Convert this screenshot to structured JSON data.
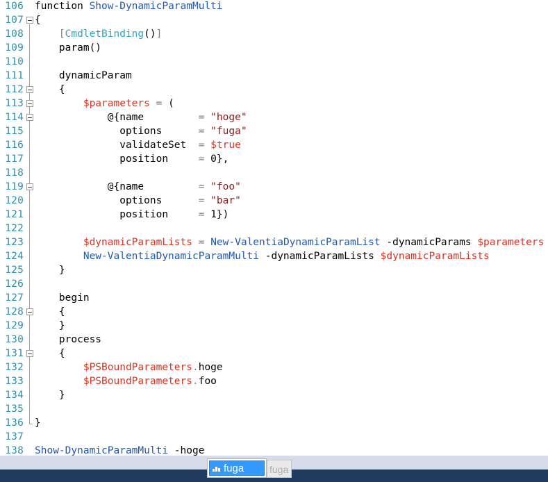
{
  "editor": {
    "lines": [
      {
        "n": "106",
        "fold": false,
        "tokens": [
          [
            "kw",
            "function "
          ],
          [
            "fn",
            "Show-DynamicParamMulti"
          ]
        ]
      },
      {
        "n": "107",
        "fold": true,
        "tokens": [
          [
            "plain",
            "{"
          ]
        ]
      },
      {
        "n": "108",
        "fold": false,
        "tokens": [
          [
            "plain",
            "    "
          ],
          [
            "op",
            "["
          ],
          [
            "attr",
            "CmdletBinding"
          ],
          [
            "plain",
            "()"
          ],
          [
            "op",
            "]"
          ]
        ]
      },
      {
        "n": "109",
        "fold": false,
        "tokens": [
          [
            "plain",
            "    param()"
          ]
        ]
      },
      {
        "n": "110",
        "fold": false,
        "tokens": []
      },
      {
        "n": "111",
        "fold": false,
        "tokens": [
          [
            "plain",
            "    dynamicParam"
          ]
        ]
      },
      {
        "n": "112",
        "fold": true,
        "tokens": [
          [
            "plain",
            "    {"
          ]
        ]
      },
      {
        "n": "113",
        "fold": true,
        "tokens": [
          [
            "plain",
            "        "
          ],
          [
            "var",
            "$parameters"
          ],
          [
            "plain",
            " "
          ],
          [
            "op",
            "="
          ],
          [
            "plain",
            " ("
          ]
        ]
      },
      {
        "n": "114",
        "fold": true,
        "tokens": [
          [
            "plain",
            "            @{name         "
          ],
          [
            "op",
            "="
          ],
          [
            "plain",
            " "
          ],
          [
            "str",
            "\"hoge\""
          ]
        ]
      },
      {
        "n": "115",
        "fold": false,
        "tokens": [
          [
            "plain",
            "              options      "
          ],
          [
            "op",
            "="
          ],
          [
            "plain",
            " "
          ],
          [
            "str",
            "\"fuga\""
          ]
        ]
      },
      {
        "n": "116",
        "fold": false,
        "tokens": [
          [
            "plain",
            "              validateSet  "
          ],
          [
            "op",
            "="
          ],
          [
            "plain",
            " "
          ],
          [
            "var",
            "$true"
          ]
        ]
      },
      {
        "n": "117",
        "fold": false,
        "tokens": [
          [
            "plain",
            "              position     "
          ],
          [
            "op",
            "="
          ],
          [
            "plain",
            " 0},"
          ]
        ]
      },
      {
        "n": "118",
        "fold": false,
        "tokens": []
      },
      {
        "n": "119",
        "fold": true,
        "tokens": [
          [
            "plain",
            "            @{name         "
          ],
          [
            "op",
            "="
          ],
          [
            "plain",
            " "
          ],
          [
            "str",
            "\"foo\""
          ]
        ]
      },
      {
        "n": "120",
        "fold": false,
        "tokens": [
          [
            "plain",
            "              options      "
          ],
          [
            "op",
            "="
          ],
          [
            "plain",
            " "
          ],
          [
            "str",
            "\"bar\""
          ]
        ]
      },
      {
        "n": "121",
        "fold": false,
        "tokens": [
          [
            "plain",
            "              position     "
          ],
          [
            "op",
            "="
          ],
          [
            "plain",
            " 1})"
          ]
        ]
      },
      {
        "n": "122",
        "fold": false,
        "tokens": []
      },
      {
        "n": "123",
        "fold": false,
        "tokens": [
          [
            "plain",
            "        "
          ],
          [
            "var",
            "$dynamicParamLists"
          ],
          [
            "plain",
            " "
          ],
          [
            "op",
            "="
          ],
          [
            "plain",
            " "
          ],
          [
            "fn",
            "New-ValentiaDynamicParamList"
          ],
          [
            "plain",
            " -dynamicParams "
          ],
          [
            "var",
            "$parameters"
          ]
        ]
      },
      {
        "n": "124",
        "fold": false,
        "tokens": [
          [
            "plain",
            "        "
          ],
          [
            "fn",
            "New-ValentiaDynamicParamMulti"
          ],
          [
            "plain",
            " -dynamicParamLists "
          ],
          [
            "var",
            "$dynamicParamLists"
          ]
        ]
      },
      {
        "n": "125",
        "fold": false,
        "tokens": [
          [
            "plain",
            "    }"
          ]
        ]
      },
      {
        "n": "126",
        "fold": false,
        "tokens": []
      },
      {
        "n": "127",
        "fold": false,
        "tokens": [
          [
            "plain",
            "    begin"
          ]
        ]
      },
      {
        "n": "128",
        "fold": true,
        "tokens": [
          [
            "plain",
            "    {"
          ]
        ]
      },
      {
        "n": "129",
        "fold": false,
        "tokens": [
          [
            "plain",
            "    }"
          ]
        ]
      },
      {
        "n": "130",
        "fold": false,
        "tokens": [
          [
            "plain",
            "    process"
          ]
        ]
      },
      {
        "n": "131",
        "fold": true,
        "tokens": [
          [
            "plain",
            "    {"
          ]
        ]
      },
      {
        "n": "132",
        "fold": false,
        "tokens": [
          [
            "plain",
            "        "
          ],
          [
            "var",
            "$PSBoundParameters"
          ],
          [
            "op",
            "."
          ],
          [
            "plain",
            "hoge"
          ]
        ]
      },
      {
        "n": "133",
        "fold": false,
        "tokens": [
          [
            "plain",
            "        "
          ],
          [
            "var",
            "$PSBoundParameters"
          ],
          [
            "op",
            "."
          ],
          [
            "plain",
            "foo"
          ]
        ]
      },
      {
        "n": "134",
        "fold": false,
        "tokens": [
          [
            "plain",
            "    }"
          ]
        ]
      },
      {
        "n": "135",
        "fold": false,
        "tokens": []
      },
      {
        "n": "136",
        "fold": false,
        "tokens": [
          [
            "plain",
            "}"
          ]
        ]
      },
      {
        "n": "137",
        "fold": false,
        "tokens": []
      },
      {
        "n": "138",
        "fold": false,
        "tokens": [
          [
            "fn",
            "Show-DynamicParamMulti"
          ],
          [
            "plain",
            " -hoge"
          ]
        ]
      }
    ]
  },
  "completion": {
    "selected_label": "fuga",
    "ghost_label": "fuga",
    "icon": "parameter-value-icon"
  },
  "colors": {
    "line_number": "#2b91af",
    "function": "#2157b3",
    "variable": "#e0301e",
    "string": "#8b1a1a",
    "operator": "#808080",
    "attribute": "#2ba5c8",
    "selection": "#3399ff",
    "status_bar": "#1f3a5c"
  }
}
